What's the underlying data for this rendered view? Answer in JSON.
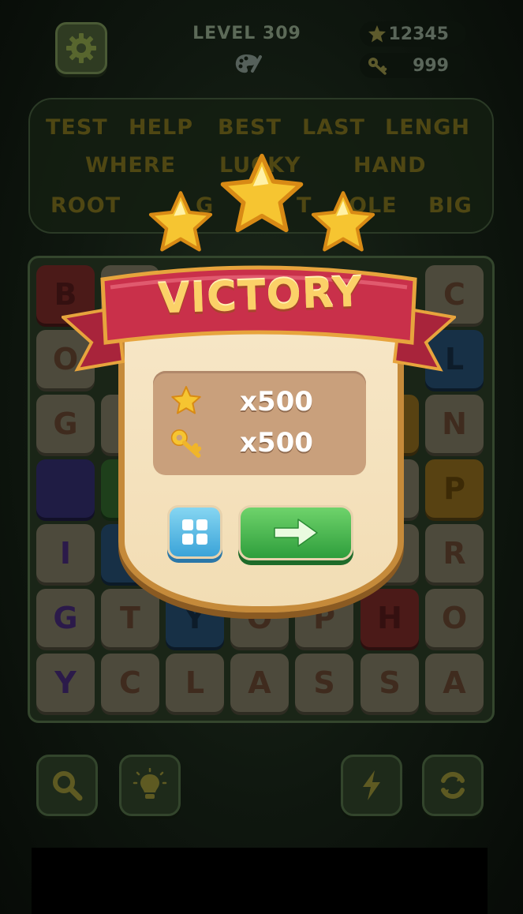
{
  "header": {
    "level": "LEVEL 309",
    "coins": "12345",
    "keys": "999"
  },
  "words": {
    "row1": [
      "TEST",
      "HELP",
      "BEST",
      "LAST",
      "LENGH"
    ],
    "row2": [
      "WHERE",
      "LUCKY",
      "HAND"
    ],
    "row3": [
      "ROOT",
      "G",
      "T",
      "OLE",
      "BIG"
    ]
  },
  "grid": {
    "row1": [
      "B",
      "C"
    ],
    "row2": [
      "O",
      "L"
    ],
    "row3": [
      "G",
      "N"
    ],
    "row4": [
      "P"
    ],
    "row5": [
      "I",
      "R"
    ],
    "row6": [
      "G",
      "T",
      "Y",
      "O",
      "P",
      "H",
      "O"
    ],
    "row7": [
      "Y",
      "C",
      "L",
      "A",
      "S",
      "S",
      "A"
    ]
  },
  "popup": {
    "title": "VICTORY",
    "stars_earned": 3,
    "reward_coins": "x500",
    "reward_keys": "x500"
  },
  "colors": {
    "gold": "#f6c531",
    "ribbon": "#c9304a",
    "popup_border": "#c58a3a",
    "next_button": "#3fae46",
    "menu_button": "#5bbde6"
  },
  "icons": {
    "settings": "gear-icon",
    "palette": "palette-icon",
    "coin": "star-icon",
    "key": "key-icon",
    "search": "magnifier-icon",
    "hint": "lightbulb-icon",
    "boost": "lightning-icon",
    "shuffle": "refresh-icon",
    "menu": "grid-icon",
    "next": "arrow-right-icon"
  }
}
